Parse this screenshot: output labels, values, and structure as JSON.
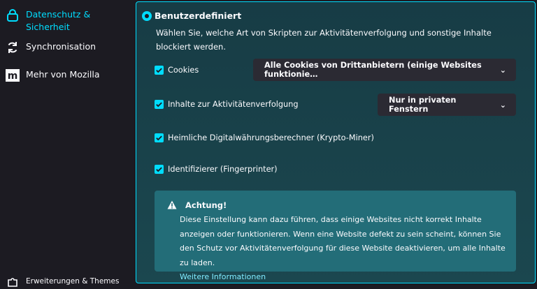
{
  "sidebar": {
    "items": [
      {
        "label": "Datenschutz & Sicherheit",
        "icon": "lock-icon",
        "active": true
      },
      {
        "label": "Synchronisation",
        "icon": "sync-icon"
      },
      {
        "label": "Mehr von Mozilla",
        "icon": "mozilla-logo-icon"
      }
    ],
    "bottom_label": "Erweiterungen & Themes"
  },
  "tracking": {
    "option_label": "Benutzerdefiniert",
    "description": "Wählen Sie, welche Art von Skripten zur Aktivitätenverfolgung und sonstige Inhalte blockiert werden.",
    "cookies": {
      "label": "Cookies",
      "checked": true,
      "dropdown_value": "Alle Cookies von Drittanbietern (einige Websites funktionie…"
    },
    "content": {
      "label": "Inhalte zur Aktivitätenverfolgung",
      "checked": true,
      "dropdown_value": "Nur in privaten Fenstern"
    },
    "cryptominers": {
      "label": "Heimliche Digitalwährungsberechner (Krypto-Miner)",
      "checked": true
    },
    "fingerprinters": {
      "label": "Identifizierer (Fingerprinter)",
      "checked": true
    }
  },
  "warning": {
    "title": "Achtung!",
    "text": "Diese Einstellung kann dazu führen, dass einige Websites nicht korrekt Inhalte anzeigen oder funktionieren. Wenn eine Website defekt zu sein scheint, können Sie den Schutz vor Aktivitätenverfolgung für diese Website deaktivieren, um alle Inhalte zu laden.",
    "link": "Weitere Informationen"
  },
  "colors": {
    "accent": "#00ddff",
    "panel": "#173c45",
    "warning_bg": "#236d78"
  }
}
